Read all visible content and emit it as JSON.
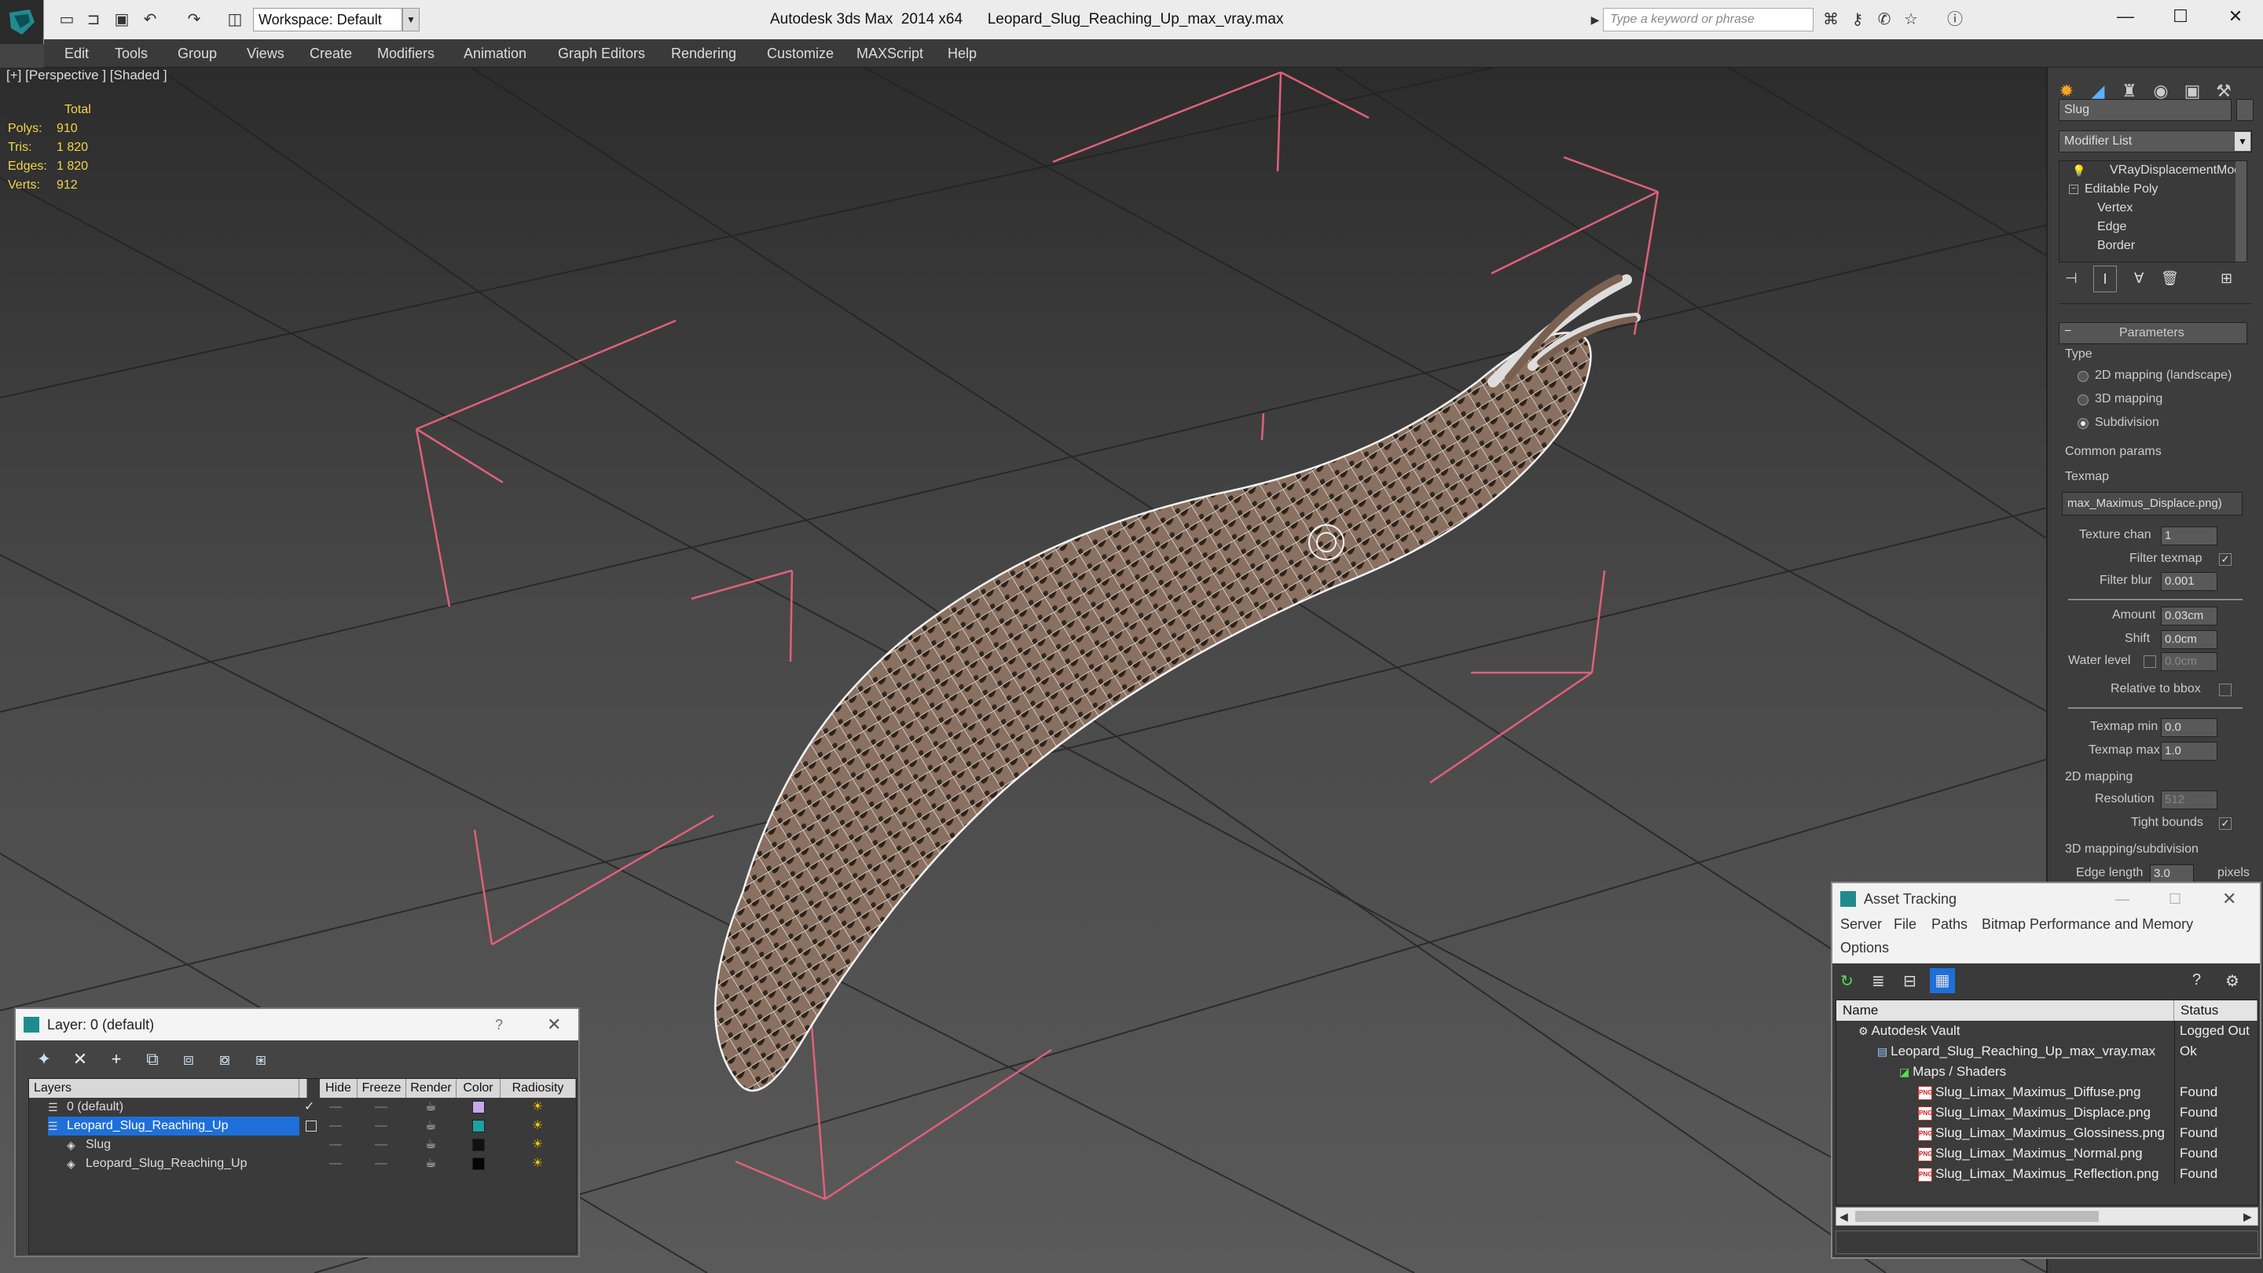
{
  "window": {
    "app_title": "Autodesk 3ds Max  2014 x64",
    "file_title": "Leopard_Slug_Reaching_Up_max_vray.max",
    "workspace": "Workspace: Default",
    "search_placeholder": "Type a keyword or phrase"
  },
  "menu": [
    "Edit",
    "Tools",
    "Group",
    "Views",
    "Create",
    "Modifiers",
    "Animation",
    "Graph Editors",
    "Rendering",
    "Customize",
    "MAXScript",
    "Help"
  ],
  "viewport": {
    "label": "[+] [Perspective ] [Shaded ]",
    "stats": {
      "header": "Total",
      "rows": [
        {
          "label": "Polys:",
          "value": "910"
        },
        {
          "label": "Tris:",
          "value": "1 820"
        },
        {
          "label": "Edges:",
          "value": "1 820"
        },
        {
          "label": "Verts:",
          "value": "912"
        }
      ]
    }
  },
  "command_panel": {
    "object_name": "Slug",
    "modifier_list": "Modifier List",
    "stack": [
      "VRayDisplacementMod",
      "Editable Poly",
      "Vertex",
      "Edge",
      "Border"
    ],
    "rollout_title": "Parameters",
    "type_label": "Type",
    "type_options": [
      "2D mapping (landscape)",
      "3D mapping",
      "Subdivision"
    ],
    "type_selected": 2,
    "common_params": "Common params",
    "texmap_label": "Texmap",
    "texmap_value": "max_Maximus_Displace.png)",
    "texture_chan_label": "Texture chan",
    "texture_chan": "1",
    "filter_texmap_label": "Filter texmap",
    "filter_blur_label": "Filter blur",
    "filter_blur": "0.001",
    "amount_label": "Amount",
    "amount": "0.03cm",
    "shift_label": "Shift",
    "shift": "0.0cm",
    "water_level_label": "Water level",
    "water_level": "0.0cm",
    "relative_bbox_label": "Relative to bbox",
    "texmap_min_label": "Texmap min",
    "texmap_min": "0.0",
    "texmap_max_label": "Texmap max",
    "texmap_max": "1.0",
    "mapping2d_label": "2D mapping",
    "resolution_label": "Resolution",
    "resolution": "512",
    "tight_bounds_label": "Tight bounds",
    "mapping3d_label": "3D mapping/subdivision",
    "edge_length_label": "Edge length",
    "edge_length": "3.0",
    "pixels_label": "pixels"
  },
  "layer_dialog": {
    "title": "Layer: 0 (default)",
    "question": "?",
    "columns": [
      "Layers",
      "Hide",
      "Freeze",
      "Render",
      "Color",
      "Radiosity"
    ],
    "rows": [
      {
        "name": "0 (default)",
        "color": "#c9a8e8"
      },
      {
        "name": "Leopard_Slug_Reaching_Up",
        "color": "#1aa3a3"
      },
      {
        "name": "Slug",
        "color": "#111111"
      },
      {
        "name": "Leopard_Slug_Reaching_Up",
        "color": "#050505"
      }
    ]
  },
  "asset_dialog": {
    "title": "Asset Tracking",
    "menu": [
      "Server",
      "File",
      "Paths",
      "Bitmap Performance and Memory",
      "Options"
    ],
    "columns": [
      "Name",
      "Status"
    ],
    "rows": [
      {
        "name": "Autodesk Vault",
        "status": "Logged Out"
      },
      {
        "name": "Leopard_Slug_Reaching_Up_max_vray.max",
        "status": "Ok"
      },
      {
        "name": "Maps / Shaders",
        "status": ""
      },
      {
        "name": "Slug_Limax_Maximus_Diffuse.png",
        "status": "Found"
      },
      {
        "name": "Slug_Limax_Maximus_Displace.png",
        "status": "Found"
      },
      {
        "name": "Slug_Limax_Maximus_Glossiness.png",
        "status": "Found"
      },
      {
        "name": "Slug_Limax_Maximus_Normal.png",
        "status": "Found"
      },
      {
        "name": "Slug_Limax_Maximus_Reflection.png",
        "status": "Found"
      }
    ]
  }
}
